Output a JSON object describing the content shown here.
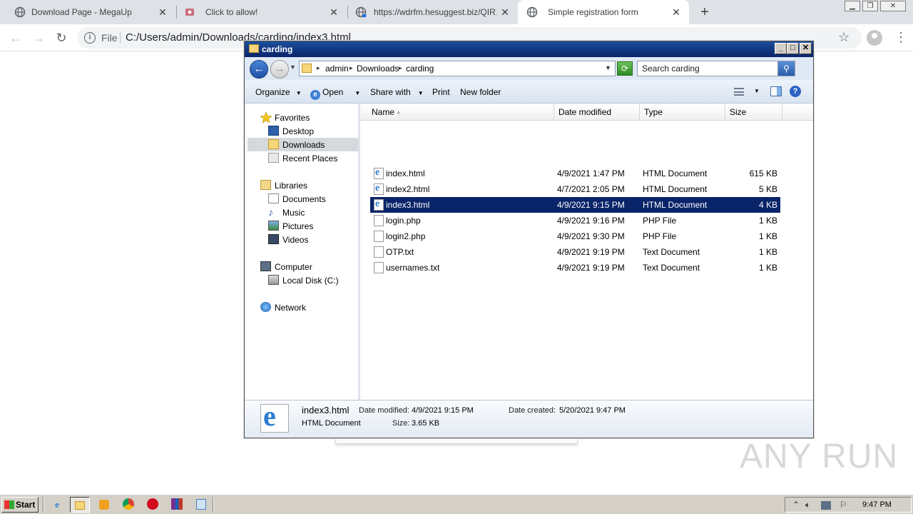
{
  "browser": {
    "tabs": [
      {
        "title": "Download Page - MegaUp"
      },
      {
        "title": "Click to allow!"
      },
      {
        "title": "https://wdrfm.hesuggest.biz/QIRXT"
      },
      {
        "title": "Simple registration form"
      }
    ],
    "address": {
      "scheme_label": "File",
      "url": "C:/Users/admin/Downloads/carding/index3.html"
    }
  },
  "explorer": {
    "title": "carding",
    "breadcrumb": [
      "admin",
      "Downloads",
      "carding"
    ],
    "search_placeholder": "Search carding",
    "commands": {
      "organize": "Organize",
      "open": "Open",
      "share": "Share with",
      "print": "Print",
      "new_folder": "New folder"
    },
    "nav": {
      "favorites": "Favorites",
      "desktop": "Desktop",
      "downloads": "Downloads",
      "recent": "Recent Places",
      "libraries": "Libraries",
      "documents": "Documents",
      "music": "Music",
      "pictures": "Pictures",
      "videos": "Videos",
      "computer": "Computer",
      "local_disk": "Local Disk (C:)",
      "network": "Network"
    },
    "columns": {
      "name": "Name",
      "date": "Date modified",
      "type": "Type",
      "size": "Size"
    },
    "files": [
      {
        "name": "index.html",
        "date": "4/9/2021 1:47 PM",
        "type": "HTML Document",
        "size": "615 KB"
      },
      {
        "name": "index2.html",
        "date": "4/7/2021 2:05 PM",
        "type": "HTML Document",
        "size": "5 KB"
      },
      {
        "name": "index3.html",
        "date": "4/9/2021 9:15 PM",
        "type": "HTML Document",
        "size": "4 KB"
      },
      {
        "name": "login.php",
        "date": "4/9/2021 9:16 PM",
        "type": "PHP File",
        "size": "1 KB"
      },
      {
        "name": "login2.php",
        "date": "4/9/2021 9:30 PM",
        "type": "PHP File",
        "size": "1 KB"
      },
      {
        "name": "OTP.txt",
        "date": "4/9/2021 9:19 PM",
        "type": "Text Document",
        "size": "1 KB"
      },
      {
        "name": "usernames.txt",
        "date": "4/9/2021 9:19 PM",
        "type": "Text Document",
        "size": "1 KB"
      }
    ],
    "details": {
      "name": "index3.html",
      "type": "HTML Document",
      "modified_label": "Date modified:",
      "modified": "4/9/2021 9:15 PM",
      "created_label": "Date created:",
      "created": "5/20/2021 9:47 PM",
      "size_label": "Size:",
      "size": "3.65 KB"
    }
  },
  "watermark": "ANY RUN",
  "taskbar": {
    "start": "Start",
    "clock": "9:47 PM"
  },
  "colors": {
    "selection": "#0a246a",
    "titlebar": "#0a246a",
    "taskbar": "#d4d0c8"
  }
}
